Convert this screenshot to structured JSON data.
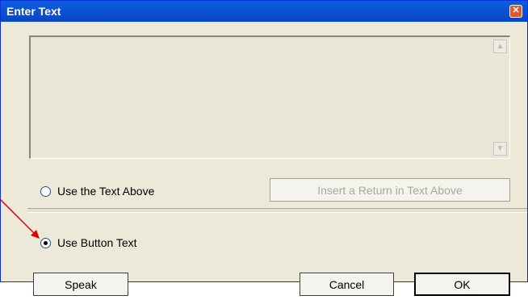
{
  "window": {
    "title": "Enter Text",
    "close_glyph": "✕"
  },
  "text_area": {
    "value": ""
  },
  "options": {
    "use_text_above": "Use the Text Above",
    "use_button_text": "Use Button Text",
    "selected": "use_button_text"
  },
  "buttons": {
    "insert_return": "Insert a Return in Text Above",
    "speak": "Speak",
    "cancel": "Cancel",
    "ok": "OK"
  },
  "colors": {
    "titlebar": "#0a5fde",
    "dialog_bg": "#ece9d8",
    "annotation_arrow": "#e00000"
  },
  "icons": {
    "scroll_up": "chevron-up-icon",
    "scroll_down": "chevron-down-icon",
    "close": "close-icon"
  }
}
